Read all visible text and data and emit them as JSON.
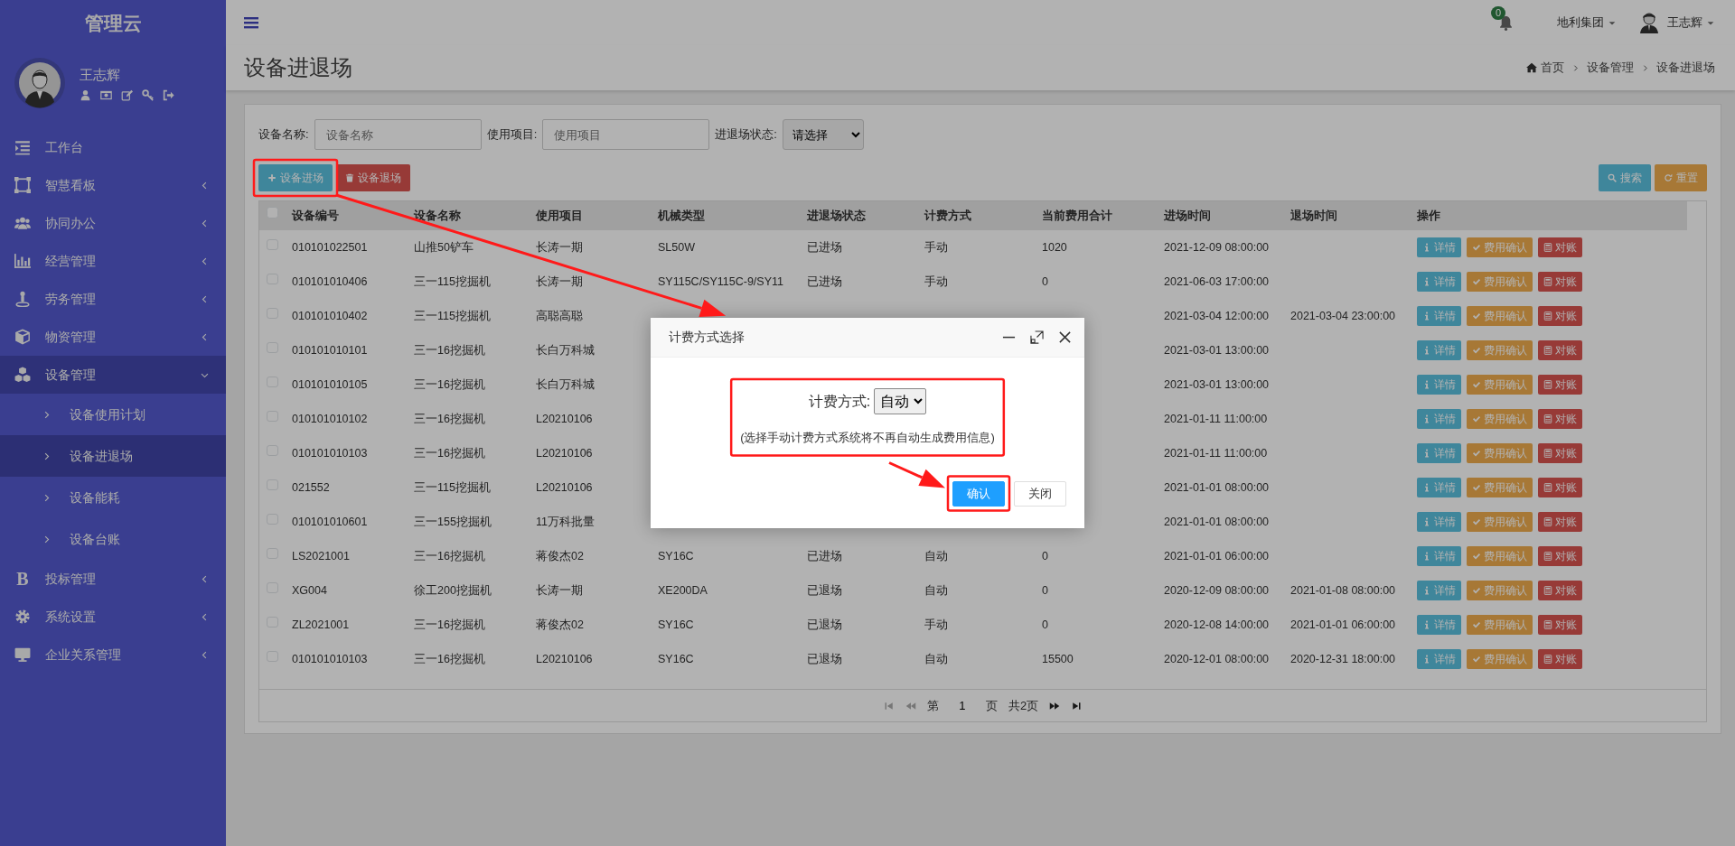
{
  "sidebar": {
    "brand": "管理云",
    "user": {
      "name": "王志辉"
    },
    "items": [
      {
        "label": "工作台",
        "selected": false
      },
      {
        "label": "智慧看板",
        "expanded": false,
        "selected": false
      },
      {
        "label": "协同办公",
        "expanded": false,
        "selected": false
      },
      {
        "label": "经营管理",
        "expanded": false,
        "selected": false
      },
      {
        "label": "劳务管理",
        "expanded": false,
        "selected": false
      },
      {
        "label": "物资管理",
        "expanded": false,
        "selected": false
      },
      {
        "label": "设备管理",
        "expanded": true,
        "selected": true,
        "children": [
          {
            "label": "设备使用计划",
            "selected": false
          },
          {
            "label": "设备进退场",
            "selected": true
          },
          {
            "label": "设备能耗",
            "selected": false
          },
          {
            "label": "设备台账",
            "selected": false
          }
        ]
      },
      {
        "label": "投标管理",
        "expanded": false,
        "selected": false,
        "glyph": "B"
      },
      {
        "label": "系统设置",
        "expanded": false,
        "selected": false
      },
      {
        "label": "企业关系管理",
        "expanded": false,
        "selected": false
      }
    ]
  },
  "header": {
    "notifications": "0",
    "company": "地利集团",
    "user": "王志辉"
  },
  "page": {
    "title": "设备进退场",
    "breadcrumb": [
      "首页",
      "设备管理",
      "设备进退场"
    ]
  },
  "filters": [
    {
      "kind": "input",
      "label": "设备名称:",
      "placeholder": "设备名称"
    },
    {
      "kind": "input",
      "label": "使用项目:",
      "placeholder": "使用项目"
    },
    {
      "kind": "select",
      "label": "进退场状态:",
      "value": "请选择"
    }
  ],
  "toolbar": {
    "left": [
      {
        "kind": "add",
        "label": "设备进场"
      },
      {
        "kind": "remove",
        "label": "设备退场"
      }
    ],
    "right": [
      {
        "kind": "search",
        "label": "搜索"
      },
      {
        "kind": "reset",
        "label": "重置"
      }
    ]
  },
  "table": {
    "header_checked": false,
    "columns": [
      "设备编号",
      "设备名称",
      "使用项目",
      "机械类型",
      "进退场状态",
      "计费方式",
      "当前费用合计",
      "进场时间",
      "退场时间",
      "操作"
    ],
    "rows": [
      {
        "checked": false,
        "cells": [
          "010101022501",
          "山推50铲车",
          "长涛一期",
          "SL50W",
          "已进场",
          "手动",
          "1020",
          "2021-12-09 08:00:00",
          null
        ],
        "actions": [
          "详情",
          "费用确认",
          "对账"
        ]
      },
      {
        "checked": false,
        "cells": [
          "010101010406",
          "三一115挖掘机",
          "长涛一期",
          "SY115C/SY115C-9/SY11",
          "已进场",
          "手动",
          "0",
          "2021-06-03 17:00:00",
          null
        ],
        "actions": [
          "详情",
          "费用确认",
          "对账"
        ]
      },
      {
        "checked": false,
        "cells": [
          "010101010402",
          "三一115挖掘机",
          "高聪高聪",
          null,
          null,
          null,
          null,
          "2021-03-04 12:00:00",
          "2021-03-04 23:00:00"
        ],
        "actions": [
          "详情",
          "费用确认",
          "对账"
        ]
      },
      {
        "checked": false,
        "cells": [
          "010101010101",
          "三一16挖掘机",
          "长白万科城",
          null,
          null,
          null,
          null,
          "2021-03-01 13:00:00",
          null
        ],
        "actions": [
          "详情",
          "费用确认",
          "对账"
        ]
      },
      {
        "checked": false,
        "cells": [
          "010101010105",
          "三一16挖掘机",
          "长白万科城",
          null,
          null,
          null,
          null,
          "2021-03-01 13:00:00",
          null
        ],
        "actions": [
          "详情",
          "费用确认",
          "对账"
        ]
      },
      {
        "checked": false,
        "cells": [
          "010101010102",
          "三一16挖掘机",
          "L20210106",
          null,
          null,
          null,
          null,
          "2021-01-11 11:00:00",
          null
        ],
        "actions": [
          "详情",
          "费用确认",
          "对账"
        ]
      },
      {
        "checked": false,
        "cells": [
          "010101010103",
          "三一16挖掘机",
          "L20210106",
          null,
          null,
          null,
          null,
          "2021-01-11 11:00:00",
          null
        ],
        "actions": [
          "详情",
          "费用确认",
          "对账"
        ]
      },
      {
        "checked": false,
        "cells": [
          "021552",
          "三一115挖掘机",
          "L20210106",
          null,
          null,
          null,
          null,
          "2021-01-01 08:00:00",
          null
        ],
        "actions": [
          "详情",
          "费用确认",
          "对账"
        ]
      },
      {
        "checked": false,
        "cells": [
          "010101010601",
          "三一155挖掘机",
          "11万科批量",
          null,
          null,
          null,
          null,
          "2021-01-01 08:00:00",
          null
        ],
        "actions": [
          "详情",
          "费用确认",
          "对账"
        ]
      },
      {
        "checked": false,
        "cells": [
          "LS2021001",
          "三一16挖掘机",
          "蒋俊杰02",
          "SY16C",
          "已进场",
          "自动",
          "0",
          "2021-01-01 06:00:00",
          null
        ],
        "actions": [
          "详情",
          "费用确认",
          "对账"
        ]
      },
      {
        "checked": false,
        "cells": [
          "XG004",
          "徐工200挖掘机",
          "长涛一期",
          "XE200DA",
          "已退场",
          "自动",
          "0",
          "2020-12-09 08:00:00",
          "2021-01-08 08:00:00"
        ],
        "actions": [
          "详情",
          "费用确认",
          "对账"
        ]
      },
      {
        "checked": false,
        "cells": [
          "ZL2021001",
          "三一16挖掘机",
          "蒋俊杰02",
          "SY16C",
          "已退场",
          "手动",
          "0",
          "2020-12-08 14:00:00",
          "2021-01-01 06:00:00"
        ],
        "actions": [
          "详情",
          "费用确认",
          "对账"
        ]
      },
      {
        "checked": false,
        "cells": [
          "010101010103",
          "三一16挖掘机",
          "L20210106",
          "SY16C",
          "已退场",
          "自动",
          "15500",
          "2020-12-01 08:00:00",
          "2020-12-31 18:00:00"
        ],
        "actions": [
          "详情",
          "费用确认",
          "对账"
        ]
      }
    ]
  },
  "pagination": {
    "controls": [
      {
        "kind": "first",
        "disabled": true
      },
      {
        "kind": "prev",
        "disabled": true
      },
      {
        "kind": "next",
        "disabled": false
      },
      {
        "kind": "last",
        "disabled": false
      }
    ],
    "page_prefix": "第",
    "page": "1",
    "page_suffix": "页",
    "total": "共2页"
  },
  "modal": {
    "title": "计费方式选择",
    "field_label": "计费方式:",
    "field_value": "自动",
    "hint": "(选择手动计费方式系统将不再自动生成费用信息)",
    "buttons": [
      {
        "kind": "primary",
        "label": "确认"
      },
      {
        "kind": "default",
        "label": "关闭"
      }
    ]
  }
}
